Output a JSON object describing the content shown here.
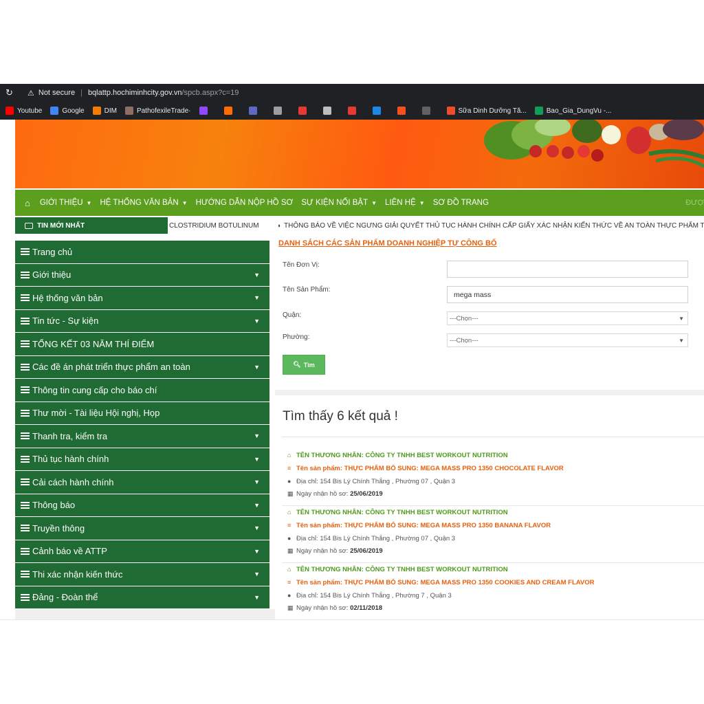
{
  "browser": {
    "security_label": "Not secure",
    "url_host": "bqlattp.hochiminhcity.gov.vn",
    "url_path": "/spcb.aspx?c=19",
    "bookmarks": [
      {
        "label": "Youtube",
        "color": "#ff0000"
      },
      {
        "label": "Google",
        "color": "#4285f4"
      },
      {
        "label": "DIM",
        "color": "#f57c00"
      },
      {
        "label": "PathofexileTrade·",
        "color": "#8d6e63"
      },
      {
        "label": "",
        "color": "#9146ff"
      },
      {
        "label": "",
        "color": "#ff6d00"
      },
      {
        "label": "",
        "color": "#5c6bc0"
      },
      {
        "label": "",
        "color": "#9e9e9e"
      },
      {
        "label": "",
        "color": "#e53935"
      },
      {
        "label": "",
        "color": "#bdbdbd"
      },
      {
        "label": "",
        "color": "#e53935"
      },
      {
        "label": "",
        "color": "#1e88e5"
      },
      {
        "label": "",
        "color": "#f4511e"
      },
      {
        "label": "",
        "color": "#616161"
      },
      {
        "label": "Sữa Dinh Dưỡng Tă...",
        "color": "#ee4d2d"
      },
      {
        "label": "Bao_Gia_DungVu -...",
        "color": "#0f9d58"
      }
    ]
  },
  "nav": {
    "items": [
      {
        "label": "GIỚI THIỆU",
        "dropdown": true
      },
      {
        "label": "HỆ THỐNG VĂN BẢN",
        "dropdown": true
      },
      {
        "label": "HƯỚNG DẪN NỘP HỒ SƠ",
        "dropdown": false
      },
      {
        "label": "SỰ KIỆN NỔI BẬT",
        "dropdown": true
      },
      {
        "label": "LIÊN HỆ",
        "dropdown": true
      },
      {
        "label": "SƠ ĐỒ TRANG",
        "dropdown": false
      }
    ],
    "right_text": "ĐƯỢ"
  },
  "ticker": {
    "label": "TIN MỚI NHẤT",
    "item1": "CLOSTRIDIUM BOTULINUM",
    "item2": "THÔNG BÁO VỀ VIỆC NGƯNG GIẢI QUYẾT THỦ TỤC HÀNH CHÍNH CẤP GIẤY XÁC NHẬN KIẾN THỨC VỀ AN TOÀN THỰC PHẨM THUỘC LĨNH"
  },
  "sidebar": {
    "items": [
      {
        "label": "Trang chủ",
        "dropdown": false
      },
      {
        "label": "Giới thiệu",
        "dropdown": true
      },
      {
        "label": "Hệ thống văn bản",
        "dropdown": true
      },
      {
        "label": "Tin tức - Sự kiện",
        "dropdown": true
      },
      {
        "label": "TỔNG KẾT 03 NĂM THÍ ĐIỂM",
        "dropdown": false
      },
      {
        "label": "Các đề án phát triển thực phẩm an toàn",
        "dropdown": true
      },
      {
        "label": "Thông tin cung cấp cho báo chí",
        "dropdown": false
      },
      {
        "label": "Thư mời - Tài liệu Hội nghị, Họp",
        "dropdown": false
      },
      {
        "label": "Thanh tra, kiểm tra",
        "dropdown": true
      },
      {
        "label": "Thủ tục hành chính",
        "dropdown": true
      },
      {
        "label": "Cải cách hành chính",
        "dropdown": true
      },
      {
        "label": "Thông báo",
        "dropdown": true
      },
      {
        "label": "Truyền thông",
        "dropdown": true
      },
      {
        "label": "Cảnh báo về ATTP",
        "dropdown": true
      },
      {
        "label": "Thi xác nhận kiến thức",
        "dropdown": true
      },
      {
        "label": "Đảng - Đoàn thể",
        "dropdown": true
      }
    ]
  },
  "search": {
    "title": "DANH SÁCH CÁC SẢN PHẨM DOANH NGHIỆP TỰ CÔNG BỐ",
    "unit_label": "Tên Đơn Vị:",
    "unit_value": "",
    "product_label": "Tên Sản Phẩm:",
    "product_value": "mega mass",
    "district_label": "Quận:",
    "district_value": "---Chọn---",
    "ward_label": "Phường:",
    "ward_value": "---Chọn---",
    "button_label": "Tìm"
  },
  "results": {
    "summary": "Tìm thấy 6 kết quả !",
    "items": [
      {
        "merchant": "TÊN THƯƠNG NHÂN: CÔNG TY TNHH BEST WORKOUT NUTRITION",
        "product": "Tên sản phẩm: THỰC PHẨM BỔ SUNG: MEGA MASS PRO 1350 CHOCOLATE FLAVOR",
        "address": "Địa chỉ: 154 Bis Lý Chính Thắng , Phường 07 , Quận 3",
        "date_label": "Ngày nhận hồ sơ:",
        "date": "25/06/2019"
      },
      {
        "merchant": "TÊN THƯƠNG NHÂN: CÔNG TY TNHH BEST WORKOUT NUTRITION",
        "product": "Tên sản phẩm: THỰC PHẨM BỔ SUNG: MEGA MASS PRO 1350 BANANA FLAVOR",
        "address": "Địa chỉ: 154 Bis Lý Chính Thắng , Phường 07 , Quận 3",
        "date_label": "Ngày nhận hồ sơ:",
        "date": "25/06/2019"
      },
      {
        "merchant": "TÊN THƯƠNG NHÂN: CÔNG TY TNHH BEST WORKOUT NUTRITION",
        "product": "Tên sản phẩm: THỰC PHẨM BỔ SUNG: MEGA MASS PRO 1350 COOKIES AND CREAM FLAVOR",
        "address": "Địa chỉ: 154 Bis Lý Chính Thắng , Phường 7 , Quận 3",
        "date_label": "Ngày nhận hồ sơ:",
        "date": "02/11/2018"
      }
    ]
  },
  "colors": {
    "nav_green": "#5c9e1e",
    "sidebar_green": "#1f6b33",
    "accent_orange": "#e8600c",
    "merchant_green": "#4f9a1b",
    "button_green": "#5cb85c"
  }
}
